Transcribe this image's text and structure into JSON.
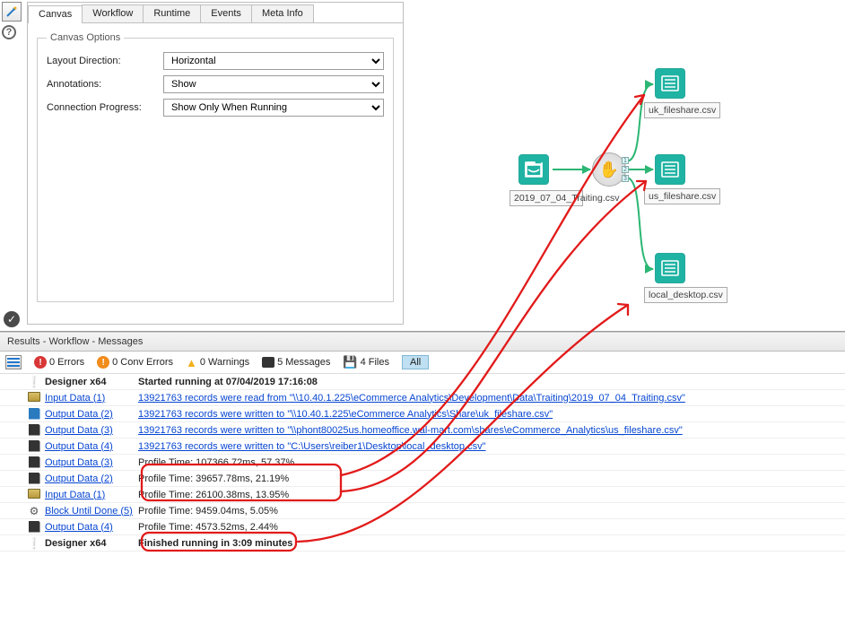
{
  "tabs": [
    "Canvas",
    "Workflow",
    "Runtime",
    "Events",
    "Meta Info"
  ],
  "active_tab": 0,
  "options_group_title": "Canvas Options",
  "options": [
    {
      "label": "Layout Direction:",
      "value": "Horizontal"
    },
    {
      "label": "Annotations:",
      "value": "Show"
    },
    {
      "label": "Connection Progress:",
      "value": "Show Only When Running"
    }
  ],
  "canvas": {
    "input_label": "2019_07_04_Traiting.csv",
    "out1_label": "uk_fileshare.csv",
    "out2_label": "us_fileshare.csv",
    "out3_label": "local_desktop.csv"
  },
  "results_title": "Results - Workflow - Messages",
  "summary": {
    "errors": "0 Errors",
    "conv": "0 Conv Errors",
    "warnings": "0 Warnings",
    "messages": "5 Messages",
    "files": "4 Files",
    "all": "All"
  },
  "rows": [
    {
      "ico": "run",
      "src": "Designer x64",
      "srclink": false,
      "msg": "Started running at 07/04/2019 17:16:08",
      "msglink": false,
      "bold": true
    },
    {
      "ico": "open",
      "src": "Input Data (1)",
      "srclink": true,
      "msg": "13921763 records were read from \"\\\\10.40.1.225\\eCommerce Analytics\\Development\\Data\\Traiting\\2019_07_04_Traiting.csv\"",
      "msglink": true
    },
    {
      "ico": "floppy-blue",
      "src": "Output Data (2)",
      "srclink": true,
      "msg": "13921763 records were written to \"\\\\10.40.1.225\\eCommerce Analytics\\Share\\uk_fileshare.csv\"",
      "msglink": true
    },
    {
      "ico": "floppy",
      "src": "Output Data (3)",
      "srclink": true,
      "msg": "13921763 records were written to \"\\\\phont80025us.homeoffice.wal-mart.com\\shares\\eCommerce_Analytics\\us_fileshare.csv\"",
      "msglink": true
    },
    {
      "ico": "floppy",
      "src": "Output Data (4)",
      "srclink": true,
      "msg": "13921763 records were written to \"C:\\Users\\reiber1\\Desktop\\local_desktop.csv\"",
      "msglink": true
    },
    {
      "ico": "floppy",
      "src": "Output Data (3)",
      "srclink": true,
      "msg": "Profile Time: 107366.72ms, 57.37%",
      "msglink": false
    },
    {
      "ico": "floppy",
      "src": "Output Data (2)",
      "srclink": true,
      "msg": "Profile Time: 39657.78ms, 21.19%",
      "msglink": false
    },
    {
      "ico": "open",
      "src": "Input Data (1)",
      "srclink": true,
      "msg": "Profile Time: 26100.38ms, 13.95%",
      "msglink": false
    },
    {
      "ico": "gear",
      "src": "Block Until Done (5)",
      "srclink": true,
      "msg": "Profile Time: 9459.04ms, 5.05%",
      "msglink": false
    },
    {
      "ico": "floppy",
      "src": "Output Data (4)",
      "srclink": true,
      "msg": "Profile Time: 4573.52ms, 2.44%",
      "msglink": false
    },
    {
      "ico": "run",
      "src": "Designer x64",
      "srclink": false,
      "msg": "Finished running in 3:09 minutes",
      "msglink": false,
      "bold": true
    }
  ]
}
